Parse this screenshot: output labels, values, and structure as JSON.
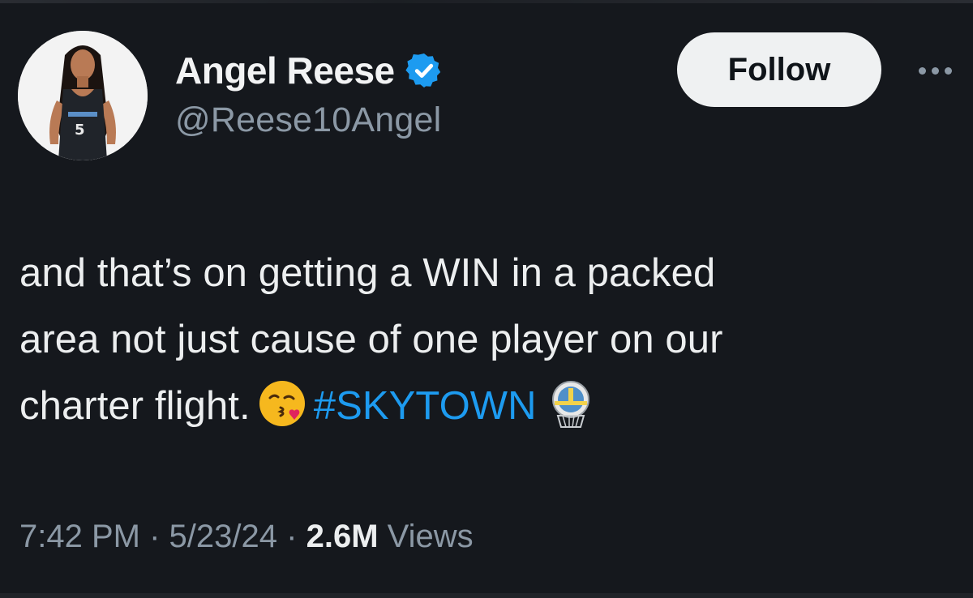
{
  "tweet": {
    "author": {
      "display_name": "Angel Reese",
      "handle": "@Reese10Angel",
      "verified": true,
      "verified_color": "#1d9bf0",
      "avatar_icon": "player-avatar"
    },
    "follow_label": "Follow",
    "more_icon": "more-options-icon",
    "text_lines": [
      "and that’s on getting a WIN in a packed",
      "area not just cause of one player on our",
      "charter flight."
    ],
    "emoji": "😘",
    "hashtag": "#SKYTOWN",
    "hashtag_color": "#1d9bf0",
    "team_icon": "chicago-sky-logo-icon",
    "time": "7:42 PM",
    "date": "5/23/24",
    "views_count": "2.6M",
    "views_label": "Views",
    "separator": "·"
  }
}
